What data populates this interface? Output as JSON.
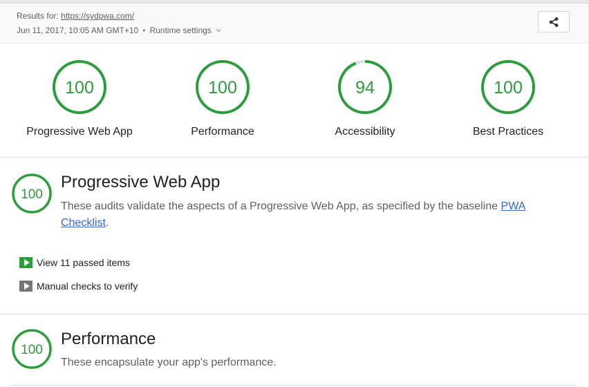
{
  "header": {
    "results_prefix": "Results for:",
    "url": "https://sydpwa.com/",
    "date": "Jun 11, 2017, 10:05 AM GMT+10",
    "separator": "•",
    "runtime_settings": "Runtime settings",
    "share_icon": "share-icon"
  },
  "summary": {
    "gauges": [
      {
        "score": "100",
        "label": "Progressive Web App",
        "value": 100
      },
      {
        "score": "100",
        "label": "Performance",
        "value": 100
      },
      {
        "score": "94",
        "label": "Accessibility",
        "value": 94
      },
      {
        "score": "100",
        "label": "Best Practices",
        "value": 100
      }
    ]
  },
  "sections": {
    "pwa": {
      "score": "100",
      "title": "Progressive Web App",
      "desc_text": "These audits validate the aspects of a Progressive Web App, as specified by the baseline ",
      "desc_link": "PWA Checklist",
      "desc_end": ".",
      "passed": "View 11 passed items",
      "manual": "Manual checks to verify"
    },
    "perf": {
      "score": "100",
      "title": "Performance",
      "desc_text": "These encapsulate your app's performance."
    }
  },
  "colors": {
    "pass": "#2d9c3c",
    "grey": "#757575",
    "link": "#3367d6"
  }
}
